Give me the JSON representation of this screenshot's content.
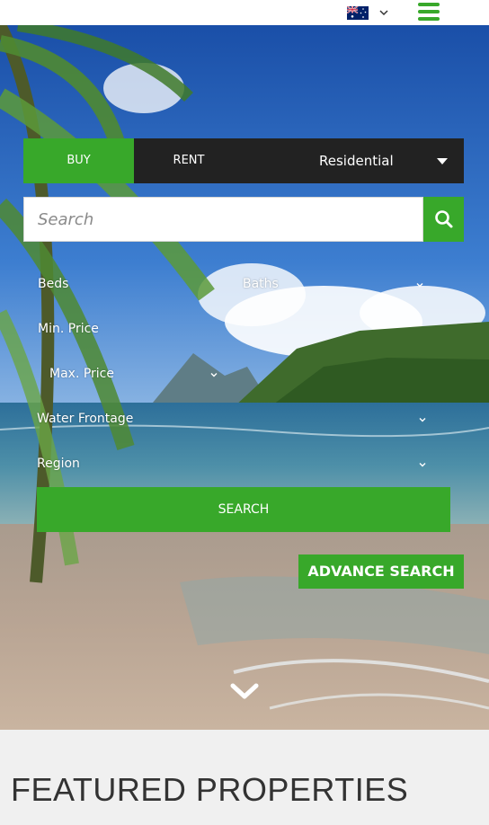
{
  "header": {
    "flag_icon": "australia-flag-icon",
    "language_chevron_icon": "chevron-down-icon",
    "menu_icon": "hamburger-menu-icon"
  },
  "search_panel": {
    "tabs": {
      "buy": "BUY",
      "rent": "RENT"
    },
    "property_type": "Residential",
    "search_placeholder": "Search",
    "search_icon": "search-icon",
    "filters": {
      "beds": "Beds",
      "baths": "Baths",
      "min_price": "Min. Price",
      "max_price": "Max. Price",
      "water_frontage": "Water Frontage",
      "region": "Region"
    },
    "submit_label": "SEARCH",
    "advance_label": "ADVANCE SEARCH"
  },
  "scroll_icon": "chevron-down-icon",
  "featured": {
    "title": "FEATURED PROPERTIES"
  },
  "colors": {
    "accent": "#38a82a",
    "dark_bar": "#222222",
    "heading": "#333333"
  }
}
